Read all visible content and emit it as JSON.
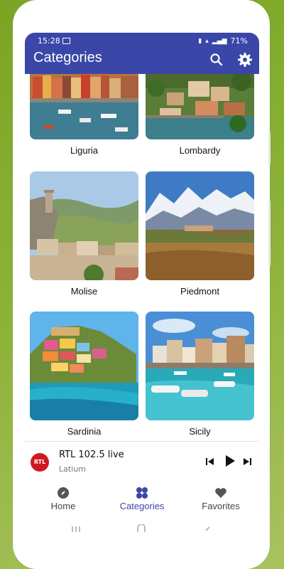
{
  "status": {
    "time": "15:28",
    "battery": "71%"
  },
  "appbar": {
    "title": "Categories"
  },
  "categories": [
    {
      "label": "Liguria"
    },
    {
      "label": "Lombardy"
    },
    {
      "label": "Molise"
    },
    {
      "label": "Piedmont"
    },
    {
      "label": "Sardinia"
    },
    {
      "label": "Sicily"
    }
  ],
  "player": {
    "station": "RTL 102.5 live",
    "region": "Latium",
    "logo_text": "RTL"
  },
  "nav": {
    "home": "Home",
    "categories": "Categories",
    "favorites": "Favorites"
  },
  "colors": {
    "primary": "#3a47a8",
    "background": "#8db33a"
  }
}
